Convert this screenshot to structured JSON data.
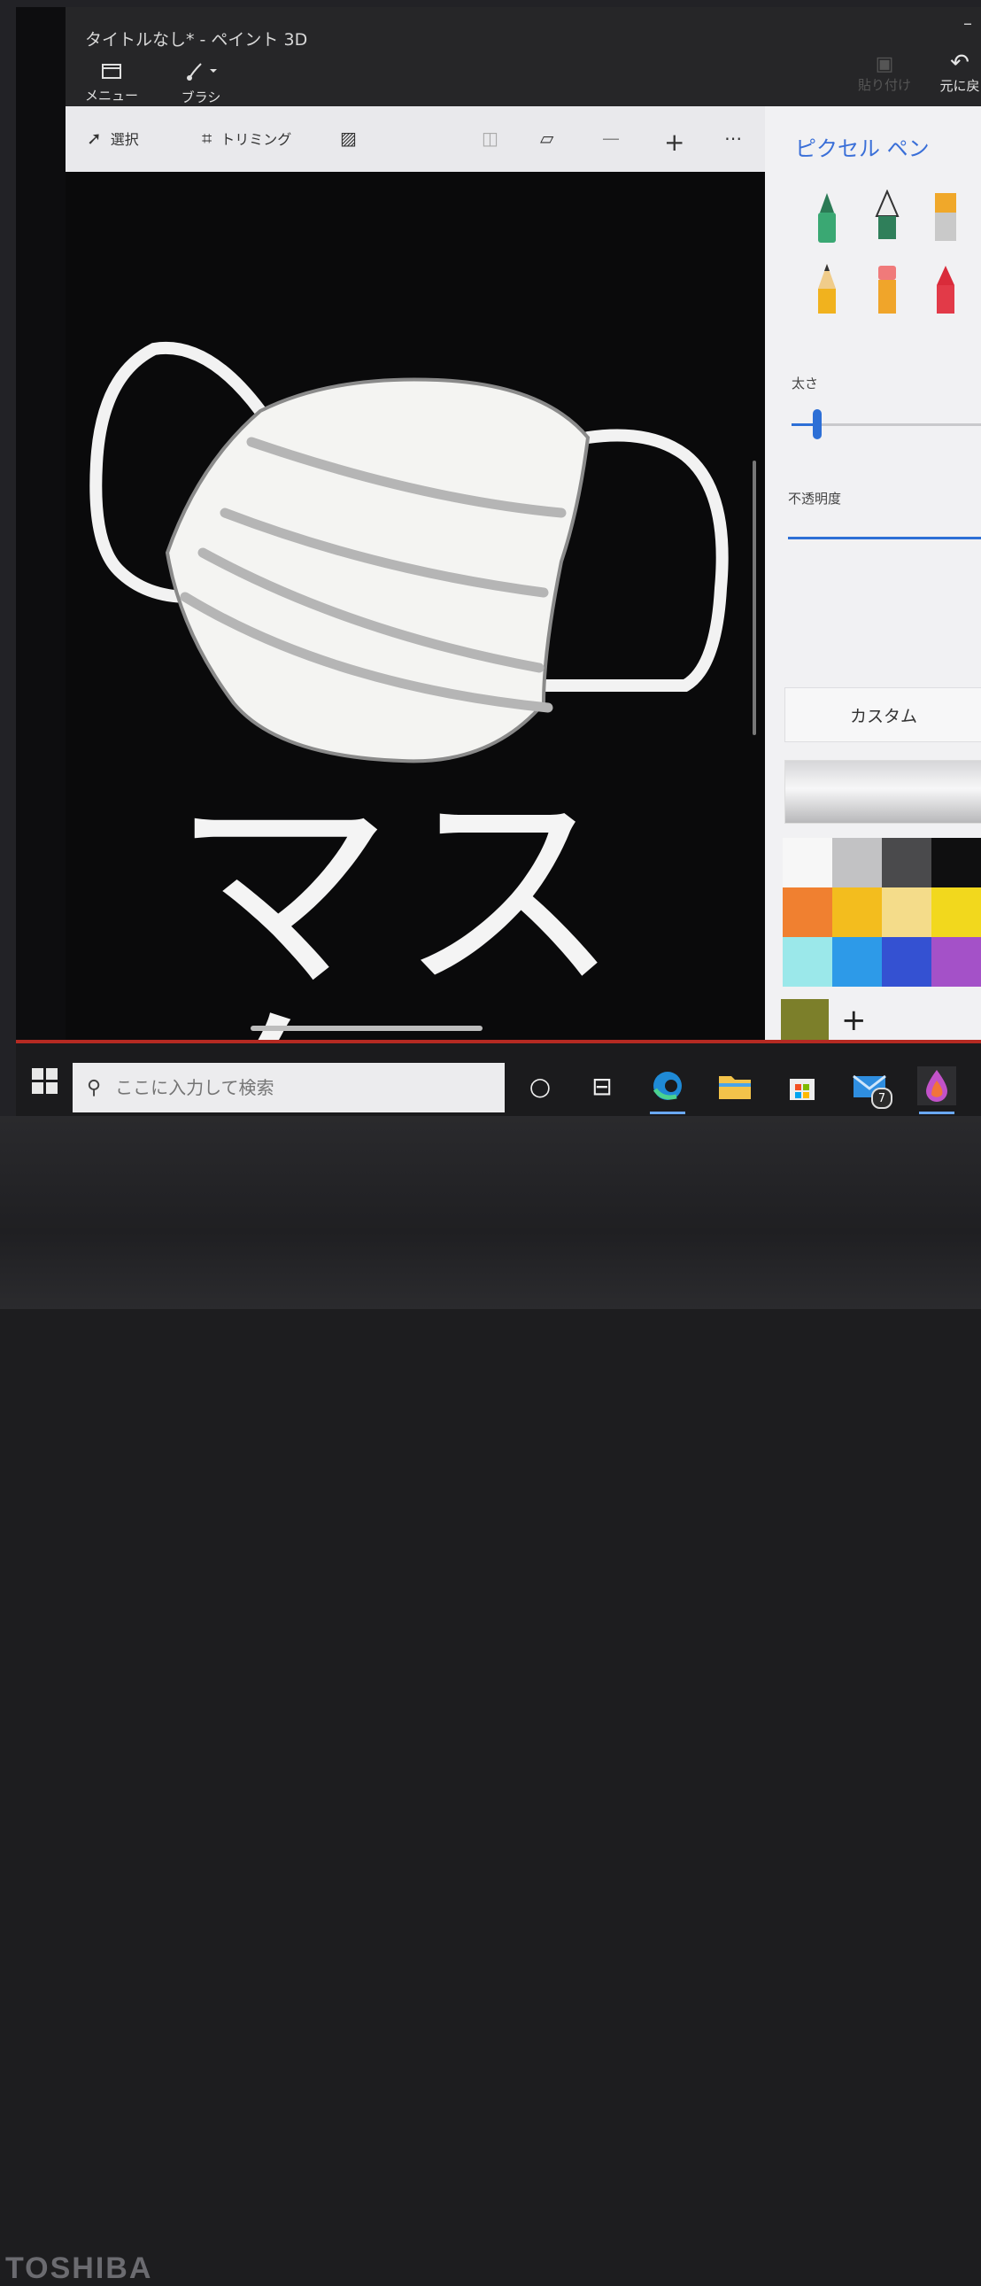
{
  "app": {
    "title": "タイトルなし* - ペイント 3D",
    "minimize": "–"
  },
  "titlebar": {
    "menu_label": "メニュー",
    "brush_label": "ブラシ",
    "paste_label": "貼り付け",
    "undo_label": "元に戻"
  },
  "toolbar": {
    "select_label": "選択",
    "crop_label": "トリミング",
    "more": "⋯"
  },
  "canvas": {
    "drawing_text": "マスク"
  },
  "panel": {
    "title": "ピクセル ペン",
    "brushes": [
      "marker",
      "calligraphy-pen",
      "oil-brush",
      "pencil",
      "eraser",
      "crayon"
    ],
    "thickness_label": "太さ",
    "thickness_value": 0.15,
    "opacity_label": "不透明度",
    "opacity_value": 1.0,
    "custom_label": "カスタム",
    "palette": [
      "#f7f7f7",
      "#c2c2c4",
      "#4a4a4c",
      "#0f0f10",
      "#f08030",
      "#f3bd1e",
      "#f4dc8a",
      "#f2d81d",
      "#9be8ea",
      "#2d9ae8",
      "#3451d2",
      "#a451c8"
    ],
    "custom_color": "#7c7f2a",
    "add_color": "+"
  },
  "taskbar": {
    "search_placeholder": "ここに入力して検索",
    "mail_badge": "7"
  },
  "device": {
    "brand": "TOSHIBA"
  }
}
